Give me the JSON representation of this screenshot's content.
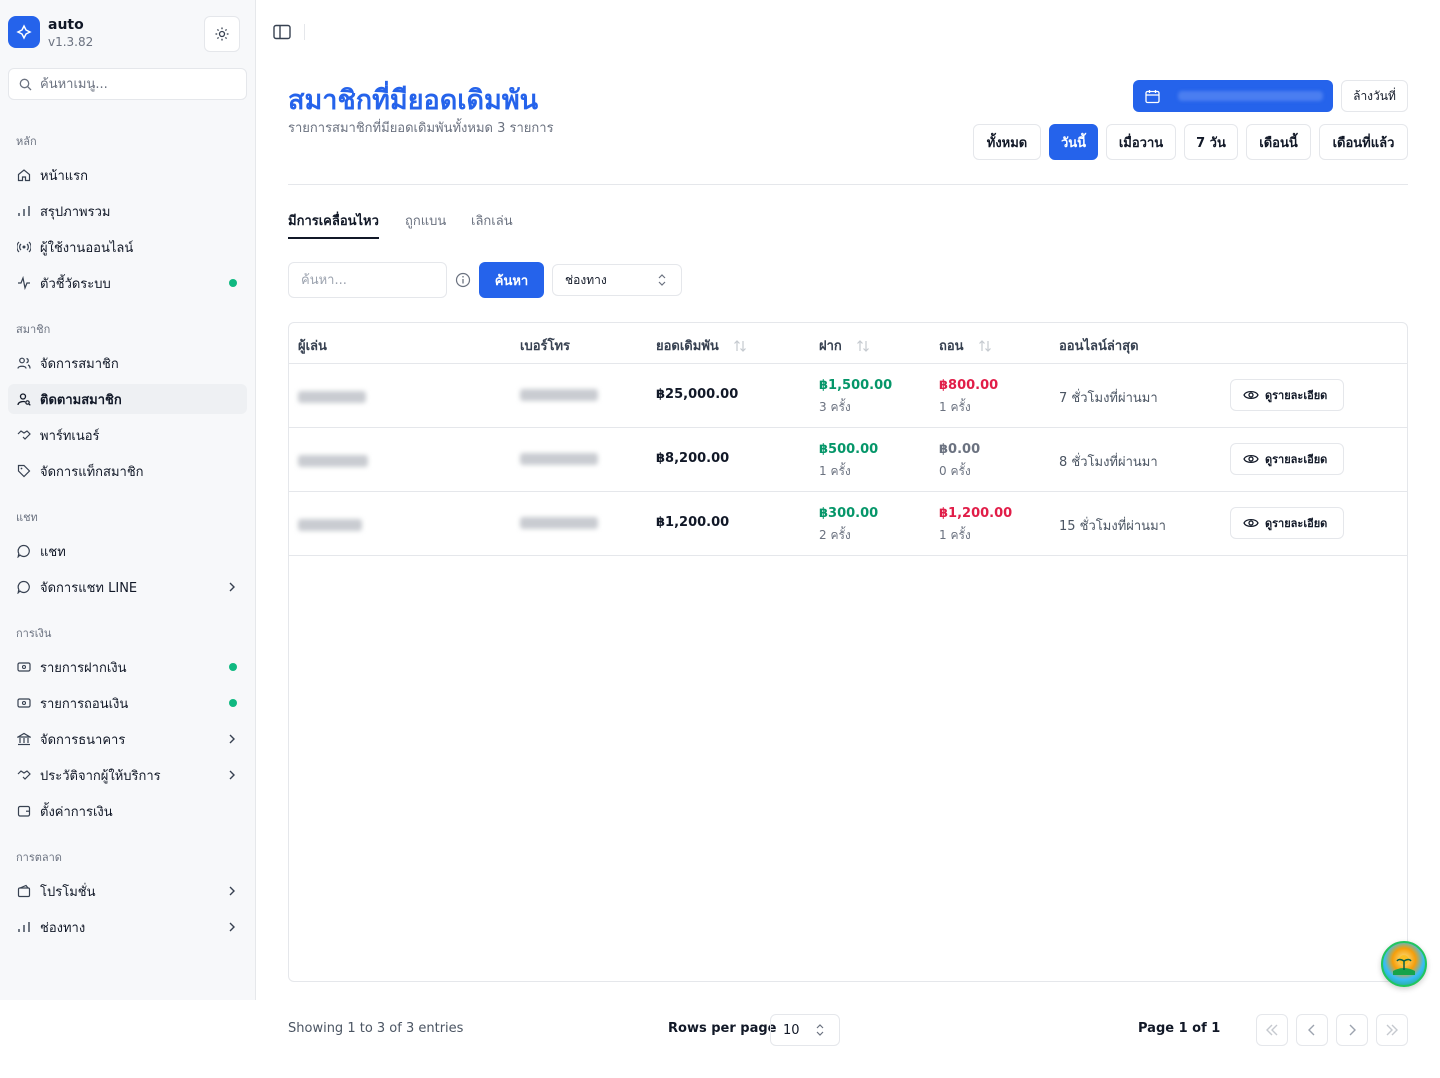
{
  "app": {
    "name": "auto",
    "version": "v1.3.82"
  },
  "sidebar": {
    "search_placeholder": "ค้นหาเมนู...",
    "groups": [
      {
        "label": "หลัก"
      },
      {
        "label": "สมาชิก"
      },
      {
        "label": "แชท"
      },
      {
        "label": "การเงิน"
      },
      {
        "label": "การตลาด"
      }
    ],
    "items": [
      {
        "label": "หน้าแรก",
        "icon": "home-icon"
      },
      {
        "label": "สรุปภาพรวม",
        "icon": "bar-chart-icon"
      },
      {
        "label": "ผู้ใช้งานออนไลน์",
        "icon": "radio-icon"
      },
      {
        "label": "ตัวชี้วัดระบบ",
        "icon": "activity-icon",
        "status_dot": "#10b981"
      },
      {
        "label": "จัดการสมาชิก",
        "icon": "users-icon"
      },
      {
        "label": "ติดตามสมาชิก",
        "icon": "user-search-icon",
        "active": true
      },
      {
        "label": "พาร์ทเนอร์",
        "icon": "handshake-icon"
      },
      {
        "label": "จัดการแท็กสมาชิก",
        "icon": "tag-icon"
      },
      {
        "label": "แชท",
        "icon": "chat-icon"
      },
      {
        "label": "จัดการแชท LINE",
        "icon": "chat-icon"
      },
      {
        "label": "รายการฝากเงิน",
        "icon": "deposit-icon",
        "status_dot": "#10b981"
      },
      {
        "label": "รายการถอนเงิน",
        "icon": "withdraw-icon",
        "status_dot": "#10b981"
      },
      {
        "label": "จัดการธนาคาร",
        "icon": "bank-icon"
      },
      {
        "label": "ประวัติจากผู้ให้บริการ",
        "icon": "provider-icon"
      },
      {
        "label": "ตั้งค่าการเงิน",
        "icon": "wallet-icon"
      },
      {
        "label": "โปรโมชั่น",
        "icon": "promo-icon"
      },
      {
        "label": "ช่องทาง",
        "icon": "bar-chart-icon"
      }
    ]
  },
  "header": {
    "title": "สมาชิกที่มียอดเดิมพัน",
    "subtitle": "รายการสมาชิกที่มียอดเดิมพันทั้งหมด 3 รายการ",
    "clear_date": "ล้างวันที่",
    "ranges": [
      "ทั้งหมด",
      "วันนี้",
      "เมื่อวาน",
      "7 วัน",
      "เดือนนี้",
      "เดือนที่แล้ว"
    ],
    "active_range": "วันนี้"
  },
  "tabs": [
    "มีการเคลื่อนไหว",
    "ถูกแบน",
    "เลิกเล่น"
  ],
  "filters": {
    "search_placeholder": "ค้นหา...",
    "search_button": "ค้นหา",
    "channel_placeholder": "ช่องทาง"
  },
  "table": {
    "columns": [
      "ผู้เล่น",
      "เบอร์โทร",
      "ยอดเดิมพัน",
      "ฝาก",
      "ถอน",
      "ออนไลน์ล่าสุด"
    ],
    "rows": [
      {
        "balance": "฿25,000.00",
        "deposit": "฿1,500.00",
        "deposit_count": "3 ครั้ง",
        "withdraw": "฿800.00",
        "withdraw_count": "1 ครั้ง",
        "withdraw_tone": "red",
        "last_online": "7 ชั่วโมงที่ผ่านมา",
        "action": "ดูรายละเอียด"
      },
      {
        "balance": "฿8,200.00",
        "deposit": "฿500.00",
        "deposit_count": "1 ครั้ง",
        "withdraw": "฿0.00",
        "withdraw_count": "0 ครั้ง",
        "withdraw_tone": "gray",
        "last_online": "8 ชั่วโมงที่ผ่านมา",
        "action": "ดูรายละเอียด"
      },
      {
        "balance": "฿1,200.00",
        "deposit": "฿300.00",
        "deposit_count": "2 ครั้ง",
        "withdraw": "฿1,200.00",
        "withdraw_count": "1 ครั้ง",
        "withdraw_tone": "red",
        "last_online": "15 ชั่วโมงที่ผ่านมา",
        "action": "ดูรายละเอียด"
      }
    ]
  },
  "footer": {
    "showing": "Showing 1 to 3 of 3 entries",
    "rows_per_page_label": "Rows per page",
    "rows_per_page": "10",
    "page": "Page 1 of 1"
  },
  "colors": {
    "accent": "#2563eb",
    "positive": "#059669",
    "negative": "#e11d48"
  }
}
